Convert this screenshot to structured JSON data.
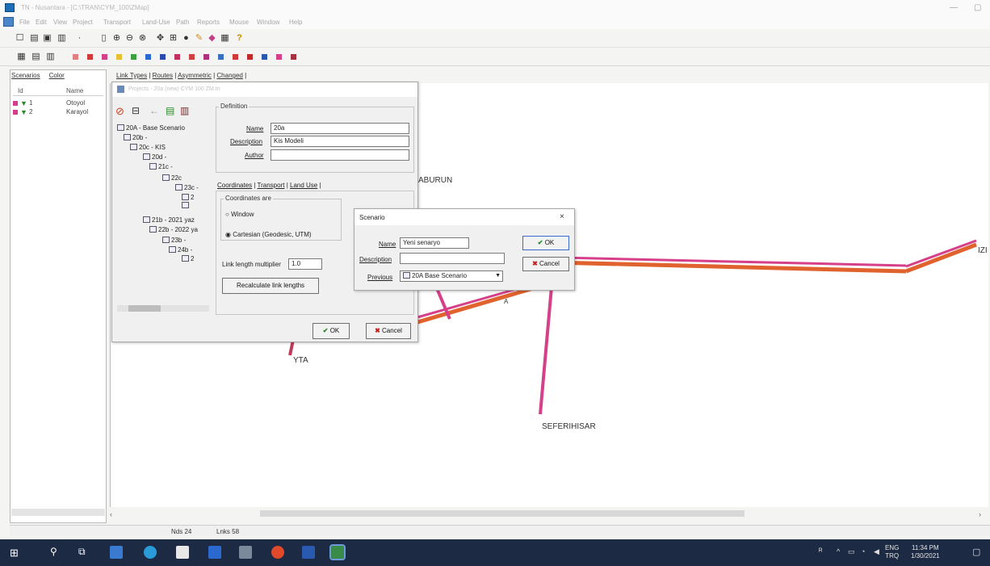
{
  "window": {
    "title": "TN - Nusantara - [C:\\TRAN\\CYM_100\\ZMap]",
    "controls": [
      "—",
      "▢"
    ]
  },
  "menu": [
    "File",
    "Edit",
    "View",
    "Project",
    "Transport",
    "Land-Use",
    "Path",
    "Reports",
    "Mouse",
    "Window",
    "Help"
  ],
  "toolbar": {
    "help_icon": "?"
  },
  "left_panel": {
    "tabs": [
      "Scenarios",
      "Color"
    ],
    "columns": [
      "Id",
      "Name"
    ],
    "rows": [
      {
        "id": "1",
        "name": "Otoyol"
      },
      {
        "id": "2",
        "name": "Karayol"
      }
    ]
  },
  "main_tabs": [
    "Link Types",
    "Routes",
    "Asymmetric",
    "Changed"
  ],
  "project_dialog": {
    "title": "Projects - 20a (new) CYM 100 ZM.tn",
    "tree": [
      "20A - Base Scenario",
      "20b -",
      "20c - KIS",
      "20d -",
      "21c -",
      "22c",
      "23c -",
      "2",
      "",
      "21b - 2021 yaz",
      "22b - 2022 ya",
      "23b -",
      "24b -",
      "2"
    ],
    "definition_label": "Definition",
    "name_label": "Name",
    "name_value": "20a",
    "description_label": "Description",
    "description_value": "Kis Modeli",
    "author_label": "Author",
    "author_value": "",
    "tabs": [
      "Coordinates",
      "Transport",
      "Land Use"
    ],
    "coords_group": "Coordinates are",
    "radio_window": "Window",
    "radio_cartesian": "Cartesian (Geodesic, UTM)",
    "link_mult_label": "Link length multiplier",
    "link_mult_value": "1.0",
    "recalc_button": "Recalculate link lengths",
    "ok": "OK",
    "cancel": "Cancel"
  },
  "scenario_dialog": {
    "title": "Scenario",
    "close": "×",
    "name_label": "Name",
    "name_value": "Yeni senaryo",
    "description_label": "Description",
    "description_value": "",
    "previous_label": "Previous",
    "previous_value": "20A Base Scenario",
    "ok": "OK",
    "cancel": "Cancel"
  },
  "map_labels": {
    "aburun": "ABURUN",
    "yta": "YTA",
    "seferihisar": "SEFERIHISAR",
    "izi": "IZI",
    "mid": "A"
  },
  "status": {
    "nodes": "Nds 24",
    "links": "Lnks 58"
  },
  "taskbar": {
    "lang_top": "ENG",
    "lang_bottom": "TRQ",
    "time": "11:34 PM",
    "date": "1/30/2021"
  },
  "colors": {
    "road_pink": "#d6408a",
    "road_orange": "#e0622e",
    "taskbar": "#1d2a43"
  }
}
